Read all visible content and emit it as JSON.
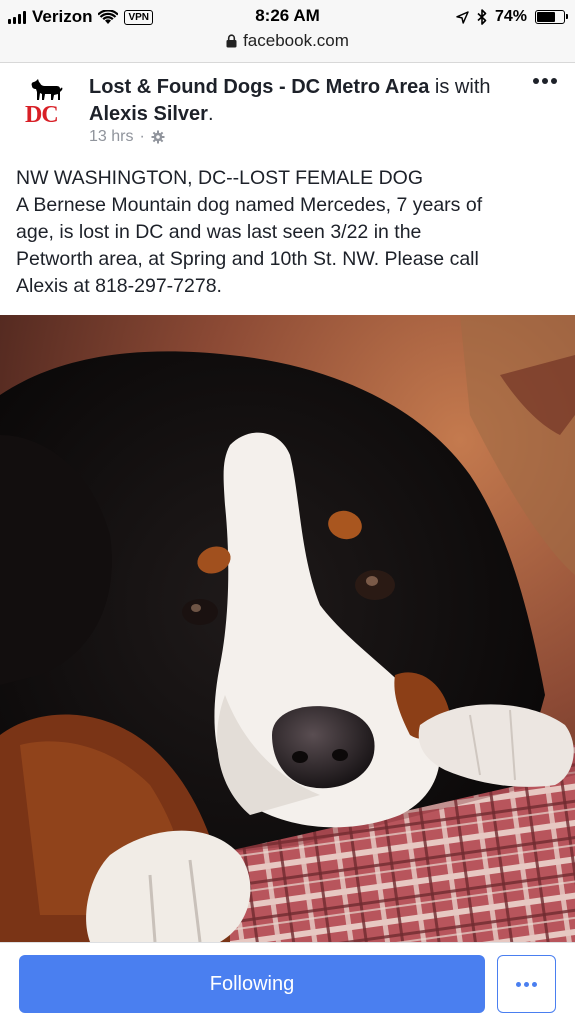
{
  "status_bar": {
    "carrier": "Verizon",
    "vpn_label": "VPN",
    "time": "8:26 AM",
    "battery": "74%",
    "battery_level": 0.74
  },
  "browser": {
    "url": "facebook.com"
  },
  "post": {
    "page_name": "Lost & Found Dogs - DC Metro Area",
    "connector": " is with ",
    "tagged_name": "Alexis Silver",
    "period": ".",
    "avatar_text": "DC",
    "timestamp": "13 hrs",
    "separator": "·",
    "text_lines": [
      "NW WASHINGTON, DC--LOST FEMALE DOG",
      "A Bernese Mountain dog named Mercedes, 7 years of",
      "age, is lost in DC and was last seen 3/22 in the",
      "Petworth area, at Spring and 10th St. NW. Please call",
      "Alexis at 818-297-7278."
    ]
  },
  "actions": {
    "following_label": "Following"
  },
  "colors": {
    "accent": "#4a7ff0",
    "logo_red": "#d81f26",
    "text": "#1d2129",
    "meta": "#90949c"
  },
  "icons": [
    "signal-icon",
    "wifi-icon",
    "location-arrow-icon",
    "bluetooth-icon",
    "battery-icon",
    "lock-icon",
    "gear-icon",
    "more-options-icon",
    "dog-silhouette-icon"
  ]
}
